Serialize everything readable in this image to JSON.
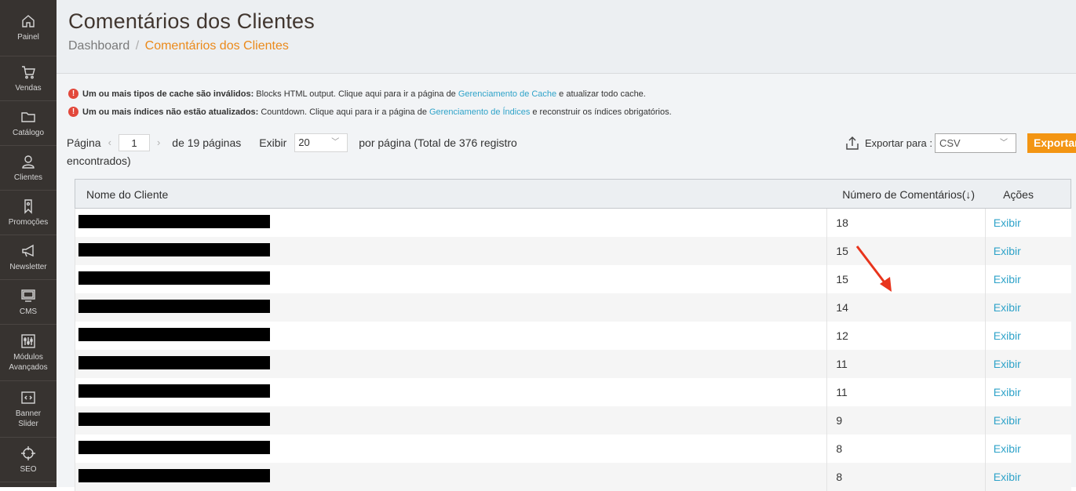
{
  "sidebar": {
    "items": [
      {
        "label": "Painel",
        "icon": "home-icon"
      },
      {
        "label": "Vendas",
        "icon": "cart-icon"
      },
      {
        "label": "Catálogo",
        "icon": "folder-icon"
      },
      {
        "label": "Clientes",
        "icon": "user-icon"
      },
      {
        "label": "Promoções",
        "icon": "tag-icon"
      },
      {
        "label": "Newsletter",
        "icon": "megaphone-icon"
      },
      {
        "label": "CMS",
        "icon": "monitor-icon"
      },
      {
        "label": "Módulos Avançados",
        "icon": "sliders-icon"
      },
      {
        "label": "Banner Slider",
        "icon": "code-window-icon"
      },
      {
        "label": "SEO",
        "icon": "crosshair-icon"
      }
    ]
  },
  "header": {
    "title": "Comentários dos Clientes",
    "breadcrumb": {
      "root": "Dashboard",
      "separator": "/",
      "current": "Comentários dos Clientes"
    }
  },
  "messages": [
    {
      "bold": "Um ou mais tipos de cache são inválidos:",
      "text_before": "Blocks HTML output. Clique aqui para ir a página de",
      "link": "Gerenciamento de Cache",
      "text_after": "e atualizar todo cache."
    },
    {
      "bold": "Um ou mais índices não estão atualizados:",
      "text_before": "Countdown. Clique aqui para ir a página de",
      "link": "Gerenciamento de Índices",
      "text_after": "e reconstruir os índices obrigatórios."
    }
  ],
  "pager": {
    "page_label": "Página",
    "prev_icon": "chevron-left-icon",
    "current_page": "1",
    "next_icon": "chevron-right-icon",
    "of_pages": "de 19 páginas",
    "show_label": "Exibir",
    "per_page": "20",
    "per_page_text": "por página (Total de 376 registro",
    "per_page_text2": "encontrados)"
  },
  "export": {
    "label": "Exportar para :",
    "format": "CSV",
    "button": "Exportar"
  },
  "table": {
    "headers": {
      "name": "Nome do Cliente",
      "count": "Número de Comentários",
      "sort_icon": "(↓)",
      "actions": "Ações"
    },
    "rows": [
      {
        "count": "18",
        "action": "Exibir"
      },
      {
        "count": "15",
        "action": "Exibir"
      },
      {
        "count": "15",
        "action": "Exibir"
      },
      {
        "count": "14",
        "action": "Exibir"
      },
      {
        "count": "12",
        "action": "Exibir"
      },
      {
        "count": "11",
        "action": "Exibir"
      },
      {
        "count": "11",
        "action": "Exibir"
      },
      {
        "count": "9",
        "action": "Exibir"
      },
      {
        "count": "8",
        "action": "Exibir"
      },
      {
        "count": "8",
        "action": "Exibir"
      }
    ]
  },
  "colors": {
    "sidebar_bg": "#373330",
    "accent_orange": "#f39513",
    "link_blue": "#2fa3c9",
    "error_red": "#e2483b",
    "annotation_arrow": "#e8341c"
  }
}
